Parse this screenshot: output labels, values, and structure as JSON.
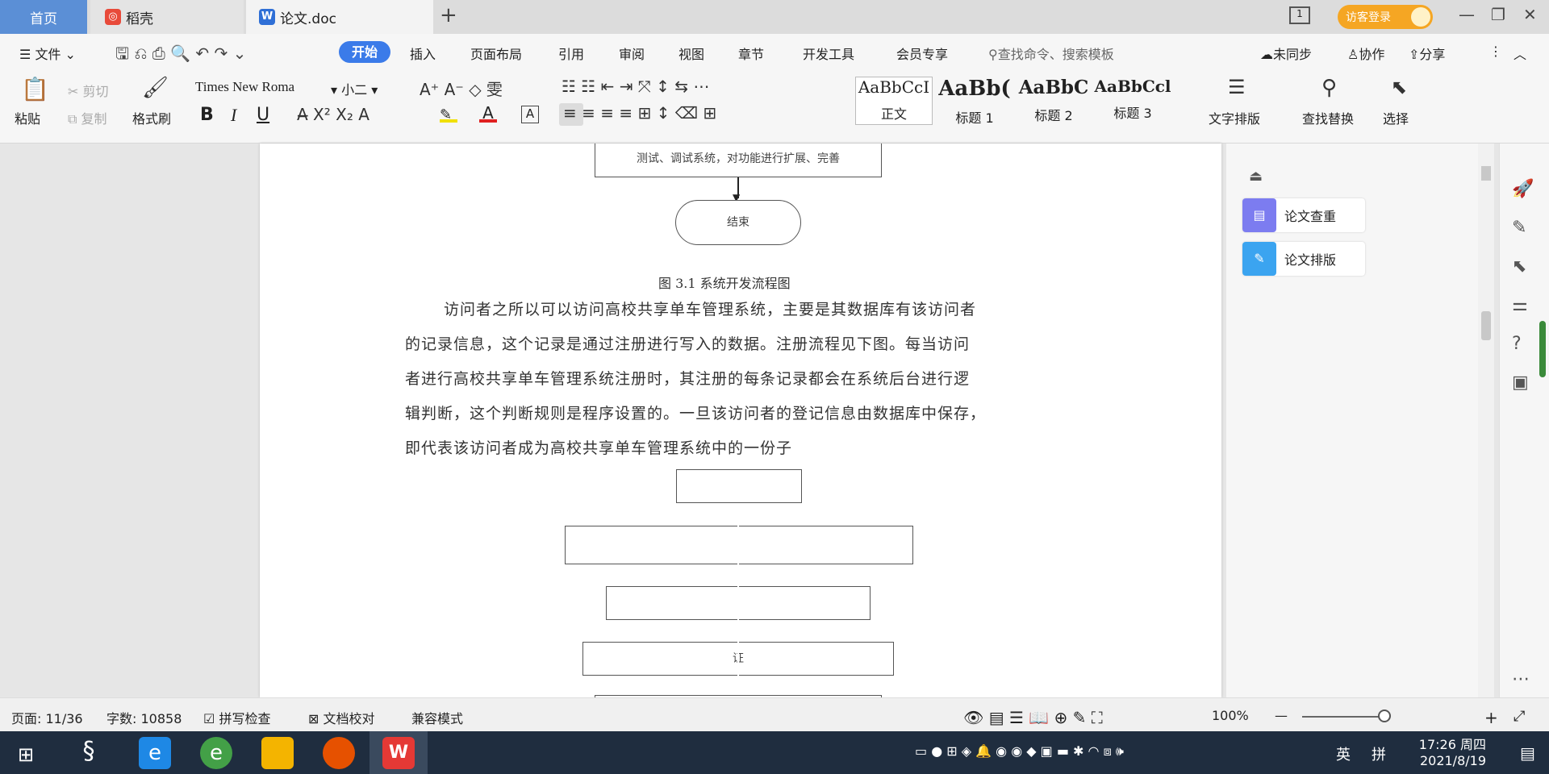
{
  "tabs": {
    "home": "首页",
    "daoke": "稻壳",
    "doc": "论文.doc",
    "new": "+"
  },
  "titlebar": {
    "login": "访客登录"
  },
  "menu": {
    "file": "文件",
    "items": [
      "开始",
      "插入",
      "页面布局",
      "引用",
      "审阅",
      "视图",
      "章节",
      "开发工具",
      "会员专享"
    ],
    "search": "查找命令、搜索模板",
    "sync": "未同步",
    "collab": "协作",
    "share": "分享"
  },
  "ribbon": {
    "paste": "粘贴",
    "cut": "剪切",
    "copy": "复制",
    "format_painter": "格式刷",
    "font": "Times New Roma",
    "size": "小二",
    "bold": "B",
    "italic": "I",
    "underline": "U",
    "styles": [
      {
        "sample": "AaBbCcI",
        "name": "正文"
      },
      {
        "sample": "AaBb(",
        "name": "标题 1"
      },
      {
        "sample": "AaBbC",
        "name": "标题 2"
      },
      {
        "sample": "AaBbCcl",
        "name": "标题 3"
      }
    ],
    "text_layout": "文字排版",
    "find_replace": "查找替换",
    "select": "选择"
  },
  "document": {
    "box_top": "测试、调试系统，对功能进行扩展、完善",
    "end_node": "结束",
    "caption": "图 3.1 系统开发流程图",
    "paragraph": [
      "访问者之所以可以访问高校共享单车管理系统，主要是其数据库有该访问者",
      "的记录信息，这个记录是通过注册进行写入的数据。注册流程见下图。每当访问",
      "者进行高校共享单车管理系统注册时，其注册的每条记录都会在系统后台进行逻",
      "辑判断，这个判断规则是程序设置的。一旦该访问者的登记信息由数据库中保存，",
      "即代表该访问者成为高校共享单车管理系统中的一份子"
    ],
    "flow2_label": "证"
  },
  "panel": {
    "check": "论文查重",
    "layout": "论文排版"
  },
  "status": {
    "page": "页面: 11/36",
    "words": "字数: 10858",
    "spell": "拼写检查",
    "proof": "文档校对",
    "compat": "兼容模式",
    "zoom": "100%"
  },
  "taskbar": {
    "lang": "英",
    "ime": "拼",
    "time": "17:26 周四",
    "date": "2021/8/19"
  },
  "colors": {
    "accent": "#3b7be9",
    "tab_home": "#5b8fd6",
    "login": "#f5a623",
    "taskbar": "#1f2d3f"
  }
}
